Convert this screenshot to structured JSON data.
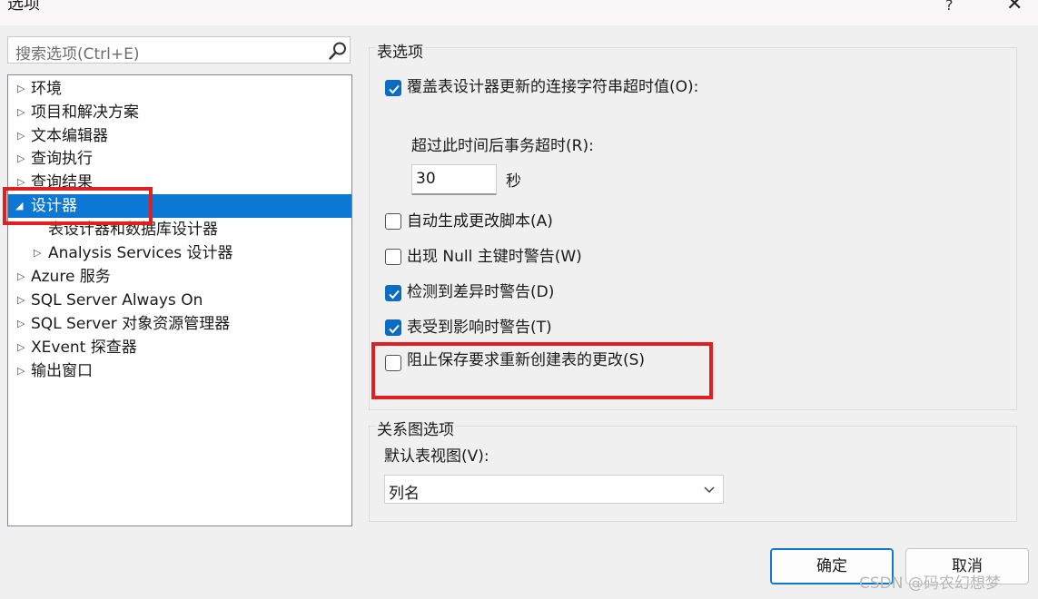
{
  "window": {
    "title": "选项",
    "help": "?",
    "close": "✕"
  },
  "search": {
    "placeholder": "搜索选项(Ctrl+E)"
  },
  "tree": {
    "items": [
      {
        "label": "环境"
      },
      {
        "label": "项目和解决方案"
      },
      {
        "label": "文本编辑器"
      },
      {
        "label": "查询执行"
      },
      {
        "label": "查询结果"
      },
      {
        "label": "设计器"
      },
      {
        "label": "表设计器和数据库设计器"
      },
      {
        "label": "Analysis Services 设计器"
      },
      {
        "label": "Azure 服务"
      },
      {
        "label": "SQL Server Always On"
      },
      {
        "label": "SQL Server 对象资源管理器"
      },
      {
        "label": "XEvent 探查器"
      },
      {
        "label": "输出窗口"
      }
    ]
  },
  "table_options": {
    "group_label": "表选项",
    "override_timeout": {
      "label": "覆盖表设计器更新的连接字符串超时值(O):",
      "checked": true
    },
    "timeout_label": "超过此时间后事务超时(R):",
    "timeout_value": "30",
    "timeout_unit": "秒",
    "auto_script": {
      "label": "自动生成更改脚本(A)",
      "checked": false
    },
    "null_pk_warn": {
      "label": "出现 Null 主键时警告(W)",
      "checked": false
    },
    "diff_warn": {
      "label": "检测到差异时警告(D)",
      "checked": true
    },
    "affected_warn": {
      "label": "表受到影响时警告(T)",
      "checked": true
    },
    "prevent_save": {
      "label": "阻止保存要求重新创建表的更改(S)",
      "checked": false
    }
  },
  "diagram_options": {
    "group_label": "关系图选项",
    "default_view_label": "默认表视图(V):",
    "default_view_value": "列名"
  },
  "buttons": {
    "ok": "确定",
    "cancel": "取消"
  },
  "watermark": "CSDN @码农幻想梦",
  "colors": {
    "selection": "#0c78d3",
    "highlight_box": "#e02020",
    "checkbox": "#0c6cbf"
  }
}
